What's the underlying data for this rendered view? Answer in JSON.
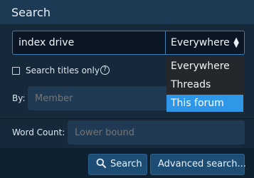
{
  "header": {
    "title": "Search"
  },
  "search": {
    "query": "index drive",
    "scope_value": "Everywhere"
  },
  "options": {
    "titles_only_label": "Search titles only",
    "titles_only_checked": false
  },
  "by": {
    "label": "By:",
    "placeholder": "Member"
  },
  "word_count": {
    "label": "Word Count:",
    "placeholder": "Lower bound"
  },
  "buttons": {
    "search_label": "Search",
    "advanced_label": "Advanced search..."
  },
  "dropdown": {
    "options": [
      "Everywhere",
      "Threads",
      "This forum"
    ],
    "selected": "This forum"
  },
  "colors": {
    "accent": "#2f97e8",
    "panel": "#16293b",
    "header": "#1d3a55"
  }
}
